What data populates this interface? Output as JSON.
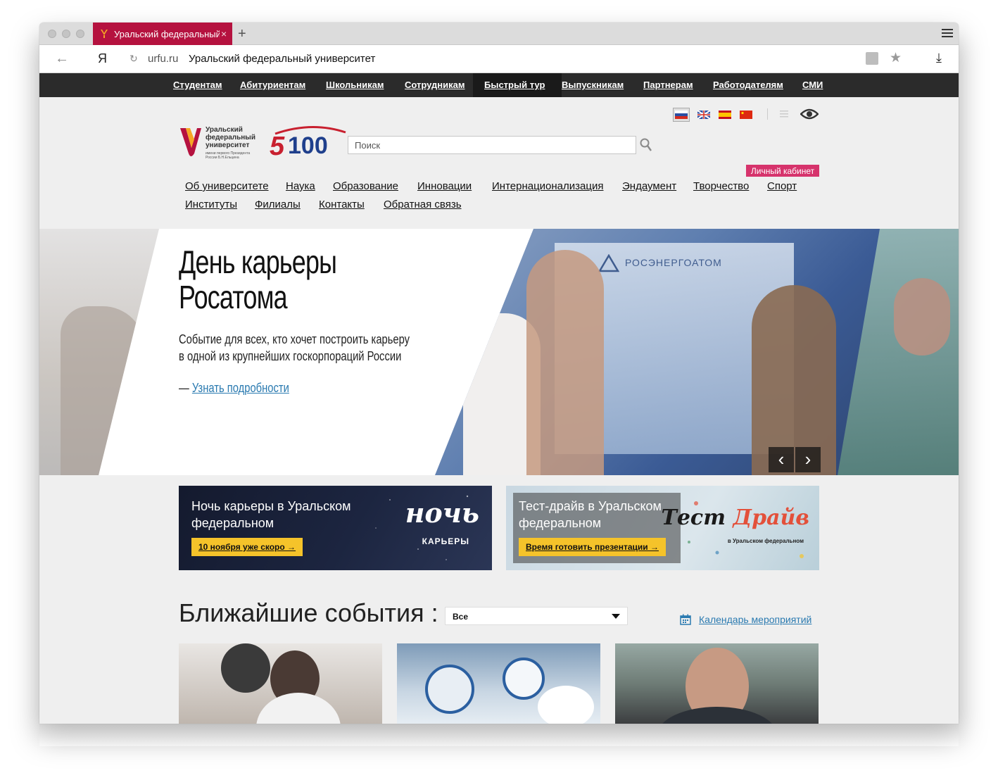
{
  "browser": {
    "tab_title": "Уральский федеральный",
    "tab_close": "×",
    "new_tab": "+",
    "back": "←",
    "yandex": "Я",
    "reload": "↻",
    "url_host": "urfu.ru",
    "url_title": "Уральский федеральный университет",
    "star": "★",
    "download": "⤓"
  },
  "topnav": {
    "items": [
      "Студентам",
      "Абитуриентам",
      "Школьникам",
      "Сотрудникам",
      "Быстрый тур",
      "Выпускникам",
      "Партнерам",
      "Работодателям",
      "СМИ"
    ],
    "active_index": 4
  },
  "header": {
    "logo_lines": [
      "Уральский",
      "федеральный",
      "университет"
    ],
    "logo_sub": "имени первого Президента России Б.Н.Ельцина",
    "logo_5100": "5100",
    "search_placeholder": "Поиск",
    "cabinet": "Личный кабинет"
  },
  "mainnav": {
    "row1": [
      "Об университете",
      "Наука",
      "Образование",
      "Инновации",
      "Интернационализация",
      "Эндаумент",
      "Творчество",
      "Спорт"
    ],
    "row2": [
      "Институты",
      "Филиалы",
      "Контакты",
      "Обратная связь"
    ]
  },
  "hero": {
    "title_line1": "День карьеры",
    "title_line2": "Росатома",
    "desc_line1": "Событие для всех, кто хочет построить карьеру",
    "desc_line2": "в одной из крупнейших госкорпораций России",
    "link_prefix": "— ",
    "link": "Узнать подробности",
    "photo_brand": "РОСЭНЕРГОАТОМ",
    "prev": "‹",
    "next": "›"
  },
  "banners": [
    {
      "title": "Ночь карьеры в Уральском федеральном",
      "button": "10 ноября уже скоро →",
      "logo": "ночь",
      "logo_sub": "КАРЬЕРЫ"
    },
    {
      "title": "Тест-драйв в Уральском федеральном",
      "button": "Время готовить презентации →",
      "logo_a": "Тест ",
      "logo_b": "Драйв",
      "logo_sub": "в Уральском федеральном"
    }
  ],
  "events": {
    "title": "Ближайшие события :",
    "filter_value": "Все",
    "calendar_link": "Календарь мероприятий"
  },
  "colors": {
    "tab": "#b5123f",
    "nav": "#2b2b2b",
    "cabinet": "#d6336c",
    "button": "#f5c32a",
    "link": "#2a7ab0"
  }
}
